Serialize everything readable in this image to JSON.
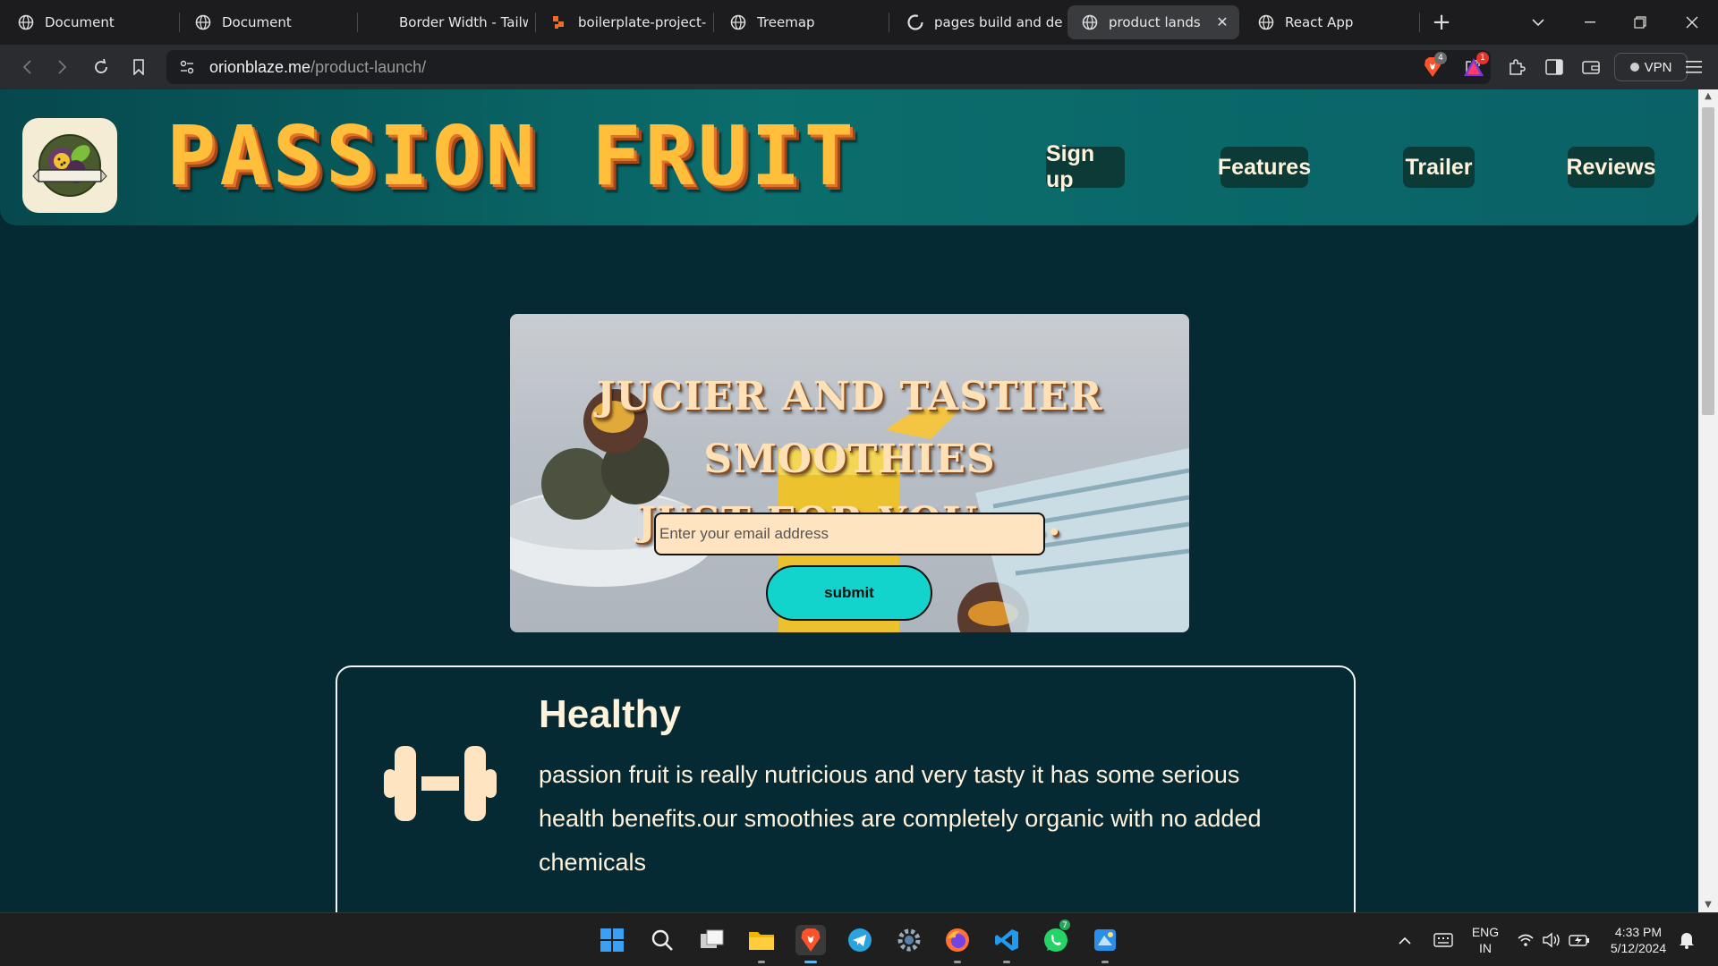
{
  "browser": {
    "tabs": [
      {
        "label": "Document",
        "icon": "globe-icon"
      },
      {
        "label": "Document",
        "icon": "globe-icon"
      },
      {
        "label": "Border Width - Tailwi",
        "icon": "tailwind-icon"
      },
      {
        "label": "boilerplate-project-u",
        "icon": "project-icon"
      },
      {
        "label": "Treemap",
        "icon": "globe-icon"
      },
      {
        "label": "pages build and depl",
        "icon": "github-icon"
      },
      {
        "label": "product lands",
        "icon": "globe-icon",
        "active": true
      },
      {
        "label": "React App",
        "icon": "globe-icon"
      }
    ],
    "url_host": "orionblaze.me",
    "url_path": "/product-launch/",
    "brave_badge": "4",
    "rewards_badge": "1",
    "vpn_label": "VPN"
  },
  "site": {
    "brand": "PASSION FRUIT",
    "nav": [
      "Sign up",
      "Features",
      "Trailer",
      "Reviews"
    ],
    "hero": {
      "title_line1": "JUCIER AND TASTIER SMOOTHIES",
      "title_line2": "JUST FOR YOU......",
      "email_placeholder": "Enter your email address",
      "submit_label": "submit"
    },
    "feature": {
      "title": "Healthy",
      "text": "passion fruit is really nutricious and very tasty it has some serious health benefits.our smoothies are completely organic with no added chemicals",
      "icon": "dumbbell-icon"
    }
  },
  "taskbar": {
    "whatsapp_badge": "7",
    "lang_line1": "ENG",
    "lang_line2": "IN",
    "time": "4:33 PM",
    "date": "5/12/2024"
  },
  "colors": {
    "page_bg": "#062a33",
    "header_teal": "#0b6d6c",
    "cream_text": "#fff3dc",
    "submit_cyan": "#12d4cc",
    "brand_gold": "#ffbf3a"
  }
}
